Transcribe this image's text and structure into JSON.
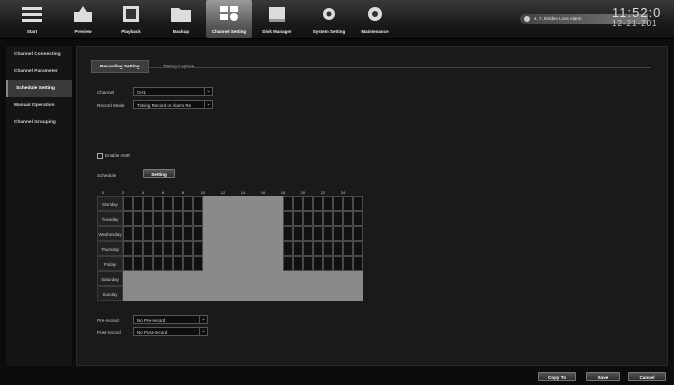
{
  "nav": [
    {
      "label": "Start",
      "icon": "menu-grid-icon"
    },
    {
      "label": "Preview",
      "icon": "preview-icon"
    },
    {
      "label": "Playback",
      "icon": "playback-icon"
    },
    {
      "label": "Backup",
      "icon": "folder-icon"
    },
    {
      "label": "Channel Setting",
      "icon": "channel-setting-icon",
      "active": true
    },
    {
      "label": "Disk Manager",
      "icon": "disk-icon"
    },
    {
      "label": "System Setting",
      "icon": "system-gear-icon"
    },
    {
      "label": "Maintenance",
      "icon": "maintenance-gear-icon"
    }
  ],
  "alarm": {
    "text": "4, 7, 8Video Loss Alarm"
  },
  "clock": {
    "time": "11:52:0",
    "date": "12-21-201"
  },
  "sidebar": {
    "items": [
      {
        "label": "Channel Connecting"
      },
      {
        "label": "Channel Parameter"
      },
      {
        "label": "Schedule Setting",
        "active": true
      },
      {
        "label": "Manual Operation"
      },
      {
        "label": "Channel Grouping"
      }
    ]
  },
  "tabs": [
    {
      "label": "Recording Setting",
      "active": true
    },
    {
      "label": "Timing Capture"
    }
  ],
  "form": {
    "channel_label": "Channel",
    "channel_value": "CH1",
    "record_mode_label": "Record Mode",
    "record_mode_value": "Timing Record or Alarm Re",
    "enable_anr_label": "Enable ANR",
    "schedule_label": "Schedule",
    "setting_button": "Setting",
    "pre_record_label": "Pre-record",
    "pre_record_value": "No Pre-record",
    "post_record_label": "Post-record",
    "post_record_value": "No Post-record"
  },
  "schedule": {
    "hours": [
      "0",
      "2",
      "4",
      "6",
      "8",
      "10",
      "12",
      "14",
      "16",
      "18",
      "20",
      "22",
      "24"
    ],
    "days": [
      {
        "name": "Monday",
        "on_ranges": [
          [
            8,
            16
          ]
        ]
      },
      {
        "name": "Tuesday",
        "on_ranges": [
          [
            8,
            16
          ]
        ]
      },
      {
        "name": "Wednesday",
        "on_ranges": [
          [
            8,
            16
          ]
        ]
      },
      {
        "name": "Thursday",
        "on_ranges": [
          [
            8,
            16
          ]
        ]
      },
      {
        "name": "Friday",
        "on_ranges": [
          [
            8,
            16
          ]
        ]
      },
      {
        "name": "Saturday",
        "on_ranges": [
          [
            0,
            24
          ]
        ]
      },
      {
        "name": "Sunday",
        "on_ranges": [
          [
            0,
            24
          ]
        ]
      }
    ]
  },
  "footer": {
    "copy_to": "Copy To",
    "save": "Save",
    "cancel": "Cancel"
  }
}
